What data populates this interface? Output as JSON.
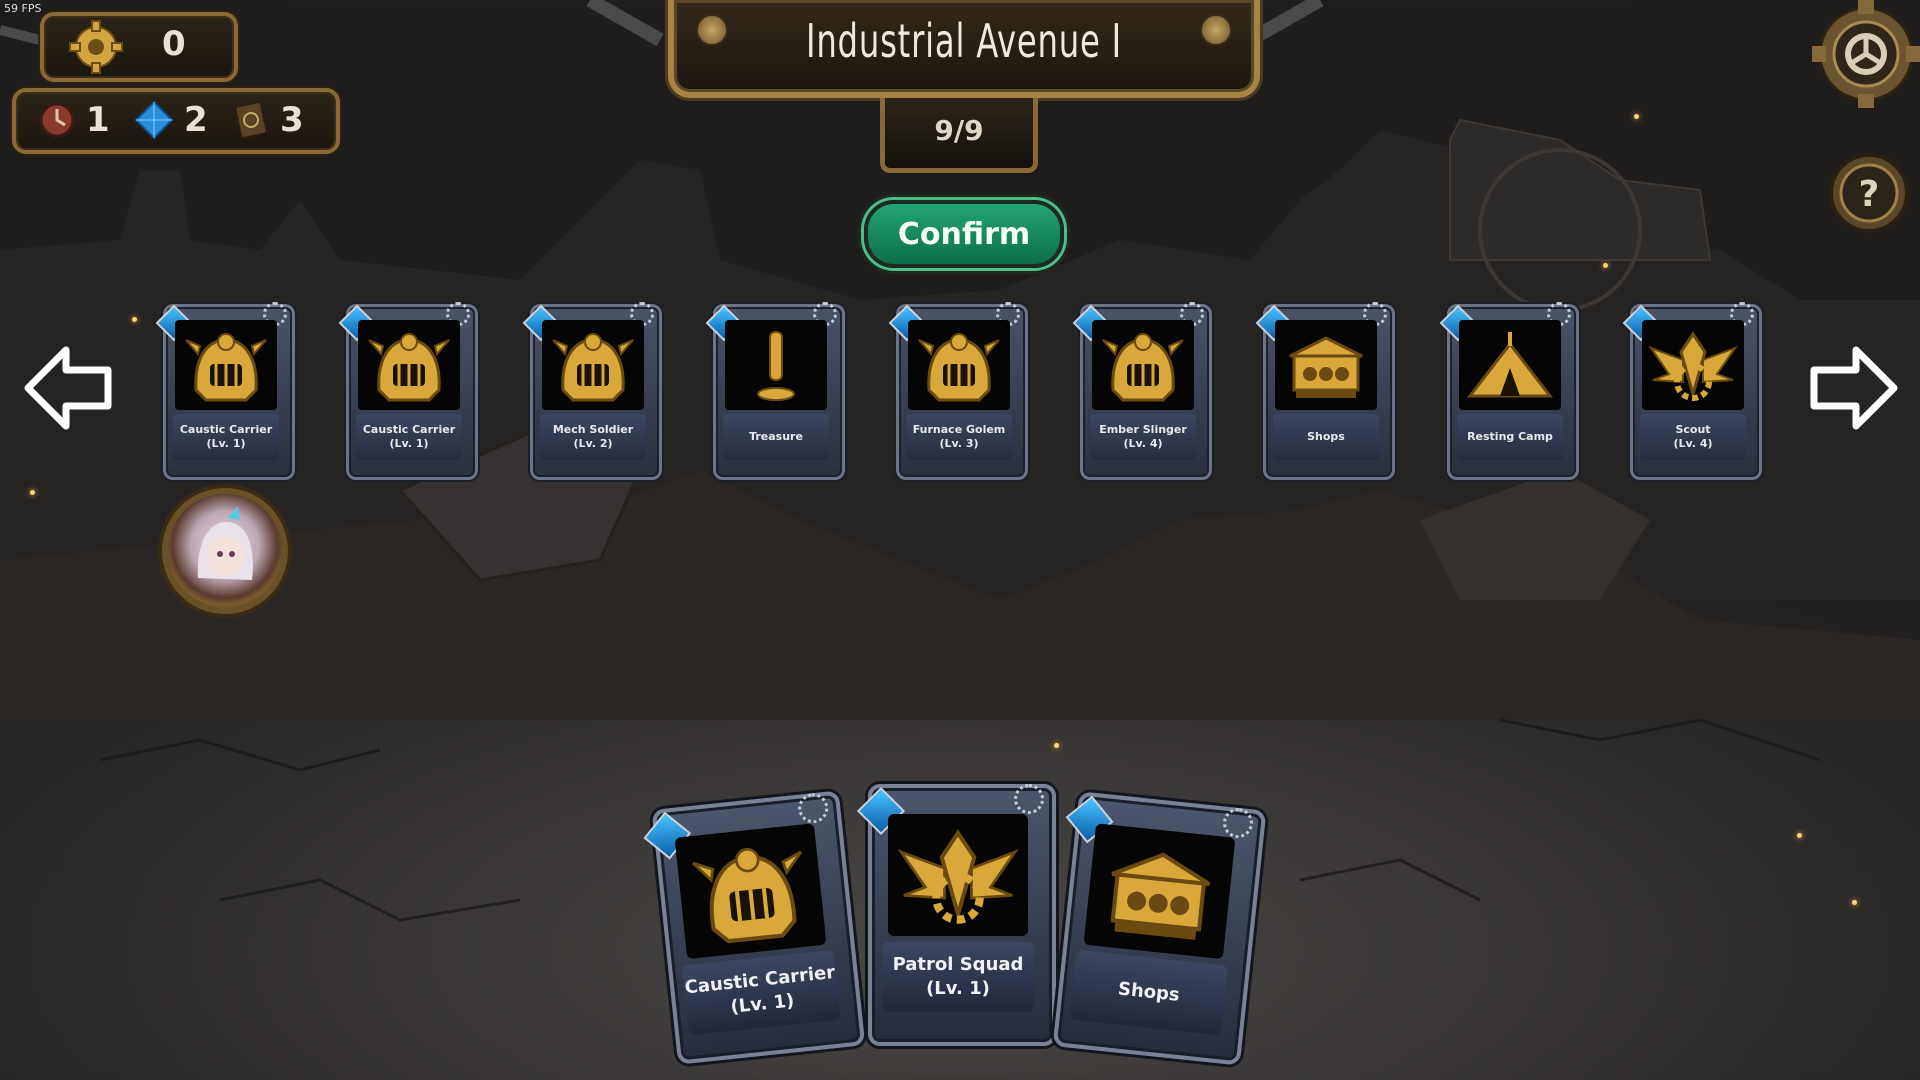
{
  "fps_label": "59 FPS",
  "currency": {
    "icon": "gear-coin-icon",
    "value": "0"
  },
  "resources": [
    {
      "icon": "clock-token-icon",
      "value": "1"
    },
    {
      "icon": "blue-gem-icon",
      "value": "2"
    },
    {
      "icon": "card-token-icon",
      "value": "3"
    }
  ],
  "stage": {
    "title": "Industrial Avenue I",
    "progress": "9/9"
  },
  "confirm_label": "Confirm",
  "path_cards": [
    {
      "name": "Caustic Carrier",
      "level": "(Lv. 1)",
      "icon": "knight-helmet-icon"
    },
    {
      "name": "Caustic Carrier",
      "level": "(Lv. 1)",
      "icon": "knight-helmet-icon"
    },
    {
      "name": "Mech Soldier",
      "level": "(Lv. 2)",
      "icon": "knight-helmet-icon"
    },
    {
      "name": "Treasure",
      "level": "",
      "icon": "exclamation-icon"
    },
    {
      "name": "Furnace Golem",
      "level": "(Lv. 3)",
      "icon": "knight-helmet-icon"
    },
    {
      "name": "Ember Slinger",
      "level": "(Lv. 4)",
      "icon": "knight-helmet-icon"
    },
    {
      "name": "Shops",
      "level": "",
      "icon": "shop-cart-icon"
    },
    {
      "name": "Resting Camp",
      "level": "",
      "icon": "tent-icon"
    },
    {
      "name": "Scout",
      "level": "(Lv. 4)",
      "icon": "winged-emblem-icon"
    }
  ],
  "hand_cards": [
    {
      "name": "Caustic Carrier",
      "level": "(Lv. 1)",
      "icon": "knight-helmet-icon"
    },
    {
      "name": "Patrol Squad",
      "level": "(Lv. 1)",
      "icon": "winged-emblem-icon"
    },
    {
      "name": "Shops",
      "level": "",
      "icon": "shop-cart-icon"
    }
  ],
  "colors": {
    "accent_gold": "#a68245",
    "confirm_green": "#17935f",
    "card_frame": "#4c566c",
    "gem_blue": "#2a8fd8"
  }
}
